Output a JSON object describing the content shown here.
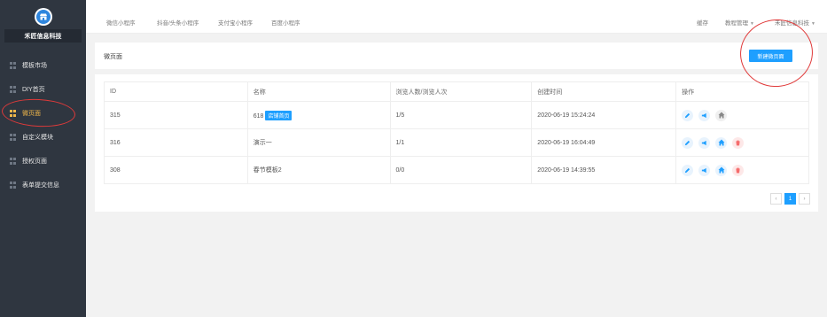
{
  "sidebar": {
    "company": "禾匠信息科技",
    "items": [
      {
        "label": "模板市场"
      },
      {
        "label": "DIY首页"
      },
      {
        "label": "微页面"
      },
      {
        "label": "自定义模块"
      },
      {
        "label": "授权页面"
      },
      {
        "label": "表单提交信息"
      }
    ]
  },
  "topbar": {
    "tabs": [
      "微信小程序",
      "抖音/头条小程序",
      "支付宝小程序",
      "百度小程序"
    ],
    "cache": "缓存",
    "tutorial": "教程管理",
    "account": "禾匠信息科技"
  },
  "header": {
    "title": "微页面",
    "new_button": "新建微页面"
  },
  "table": {
    "columns": [
      "ID",
      "名称",
      "浏览人数/浏览人次",
      "创建时间",
      "操作"
    ],
    "rows": [
      {
        "id": "315",
        "name": "618",
        "tag": "店铺首页",
        "views": "1/5",
        "created": "2020-06-19 15:24:24"
      },
      {
        "id": "316",
        "name": "演示一",
        "tag": "",
        "views": "1/1",
        "created": "2020-06-19 16:04:49"
      },
      {
        "id": "308",
        "name": "春节模板2",
        "tag": "",
        "views": "0/0",
        "created": "2020-06-19 14:39:55"
      }
    ]
  },
  "pagination": {
    "prev": "‹",
    "current": "1",
    "next": "›"
  },
  "colors": {
    "sidebar_bg": "#2f3640",
    "accent": "#1e9fff",
    "active_menu": "#f0b74a",
    "annotation": "#e03a3a"
  }
}
